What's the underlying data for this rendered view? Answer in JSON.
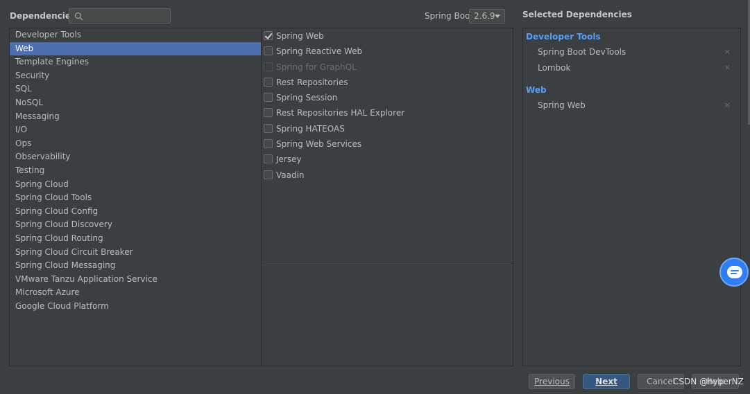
{
  "header": {
    "dependencies_label": "Dependencies",
    "search_value": "",
    "spring_boot_label": "Spring Boot",
    "spring_boot_version": "2.6.9",
    "selected_title": "Selected Dependencies"
  },
  "categories": [
    {
      "label": "Developer Tools",
      "selected": false
    },
    {
      "label": "Web",
      "selected": true
    },
    {
      "label": "Template Engines",
      "selected": false
    },
    {
      "label": "Security",
      "selected": false
    },
    {
      "label": "SQL",
      "selected": false
    },
    {
      "label": "NoSQL",
      "selected": false
    },
    {
      "label": "Messaging",
      "selected": false
    },
    {
      "label": "I/O",
      "selected": false
    },
    {
      "label": "Ops",
      "selected": false
    },
    {
      "label": "Observability",
      "selected": false
    },
    {
      "label": "Testing",
      "selected": false
    },
    {
      "label": "Spring Cloud",
      "selected": false
    },
    {
      "label": "Spring Cloud Tools",
      "selected": false
    },
    {
      "label": "Spring Cloud Config",
      "selected": false
    },
    {
      "label": "Spring Cloud Discovery",
      "selected": false
    },
    {
      "label": "Spring Cloud Routing",
      "selected": false
    },
    {
      "label": "Spring Cloud Circuit Breaker",
      "selected": false
    },
    {
      "label": "Spring Cloud Messaging",
      "selected": false
    },
    {
      "label": "VMware Tanzu Application Service",
      "selected": false
    },
    {
      "label": "Microsoft Azure",
      "selected": false
    },
    {
      "label": "Google Cloud Platform",
      "selected": false
    }
  ],
  "dependencies": [
    {
      "label": "Spring Web",
      "checked": true,
      "disabled": false
    },
    {
      "label": "Spring Reactive Web",
      "checked": false,
      "disabled": false
    },
    {
      "label": "Spring for GraphQL",
      "checked": false,
      "disabled": true
    },
    {
      "label": "Rest Repositories",
      "checked": false,
      "disabled": false
    },
    {
      "label": "Spring Session",
      "checked": false,
      "disabled": false
    },
    {
      "label": "Rest Repositories HAL Explorer",
      "checked": false,
      "disabled": false
    },
    {
      "label": "Spring HATEOAS",
      "checked": false,
      "disabled": false
    },
    {
      "label": "Spring Web Services",
      "checked": false,
      "disabled": false
    },
    {
      "label": "Jersey",
      "checked": false,
      "disabled": false
    },
    {
      "label": "Vaadin",
      "checked": false,
      "disabled": false
    }
  ],
  "selected_groups": [
    {
      "title": "Developer Tools",
      "items": [
        "Spring Boot DevTools",
        "Lombok"
      ]
    },
    {
      "title": "Web",
      "items": [
        "Spring Web"
      ]
    }
  ],
  "remove_glyph": "×",
  "buttons": {
    "previous": "Previous",
    "next": "Next",
    "cancel": "Cancel",
    "help": "Help"
  },
  "watermark": "CSDN @hyperNZ",
  "colors": {
    "background": "#3c3f41",
    "selection": "#4b6eaf",
    "group_heading": "#589df6",
    "primary_button": "#365880"
  },
  "icons": {
    "search": "search-icon",
    "dropdown": "chevron-down-icon",
    "remove": "close-icon",
    "chat": "chat-icon"
  }
}
